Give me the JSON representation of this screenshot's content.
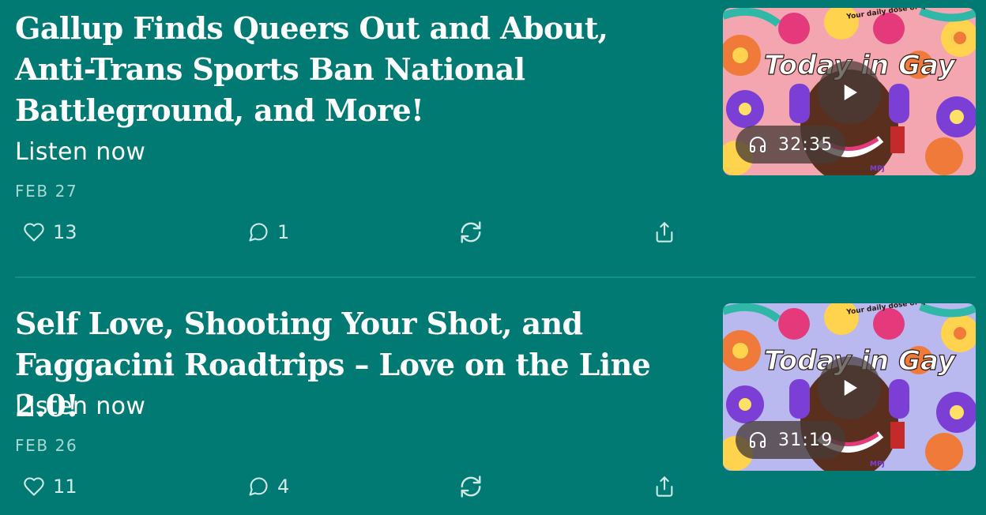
{
  "posts": [
    {
      "title": "Gallup Finds Queers Out and About, Anti-Trans Sports Ban National Battleground, and More!",
      "subtitle": "Listen now",
      "date": "FEB 27",
      "likes": "13",
      "comments": "1",
      "duration": "32:35",
      "artwork": {
        "show_title": "Today in Gay",
        "tagline": "Your daily dose of queer news!",
        "signature": "MPJ",
        "background_color": "#f4a6b0"
      }
    },
    {
      "title": "Self Love, Shooting Your Shot, and Faggacini Roadtrips – Love on the Line 2.0!",
      "subtitle": "Listen now",
      "date": "FEB 26",
      "likes": "11",
      "comments": "4",
      "duration": "31:19",
      "artwork": {
        "show_title": "Today in Gay",
        "tagline": "Your daily dose of queer news!",
        "signature": "MPJ",
        "background_color": "#b9b8ef"
      }
    }
  ],
  "icons": {
    "like": "heart-icon",
    "comment": "speech-bubble-icon",
    "restack": "restack-icon",
    "share": "share-icon",
    "play": "play-icon",
    "duration": "headphones-icon"
  },
  "colors": {
    "background": "#007a73",
    "text": "#ffffff",
    "muted": "#a7d8d3",
    "divider": "#11908a"
  }
}
